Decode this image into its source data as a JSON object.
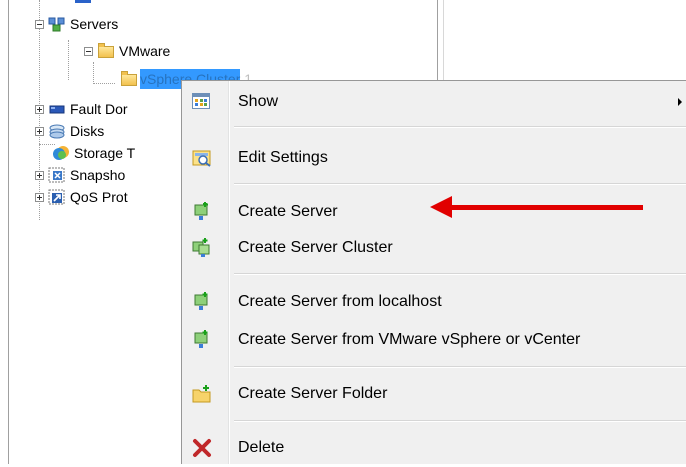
{
  "tree": {
    "items": [
      {
        "label": "Servers",
        "icon": "servers-icon"
      },
      {
        "label": "VMware",
        "icon": "folder-icon"
      },
      {
        "label": "vSphere Cluster 1",
        "icon": "folder-icon"
      },
      {
        "label": "Fault Dor",
        "icon": "fault-domain-icon"
      },
      {
        "label": "Disks",
        "icon": "disks-icon"
      },
      {
        "label": "Storage T",
        "icon": "storage-icon"
      },
      {
        "label": "Snapsho",
        "icon": "snapshot-icon"
      },
      {
        "label": "QoS Prot",
        "icon": "qos-icon"
      }
    ]
  },
  "context_menu": {
    "items": [
      {
        "label": "Show",
        "icon": "show-grid-icon",
        "has_submenu": true
      },
      {
        "label": "Edit Settings",
        "icon": "edit-settings-icon"
      },
      {
        "label": "Create Server",
        "icon": "create-server-icon"
      },
      {
        "label": "Create Server Cluster",
        "icon": "create-server-cluster-icon"
      },
      {
        "label": "Create Server from localhost",
        "icon": "create-server-localhost-icon"
      },
      {
        "label": "Create Server from VMware vSphere or vCenter",
        "icon": "create-server-vmware-icon"
      },
      {
        "label": "Create Server Folder",
        "icon": "create-folder-icon"
      },
      {
        "label": "Delete",
        "icon": "delete-icon"
      }
    ]
  },
  "colors": {
    "selection": "#3399ff",
    "annotation_arrow": "#e10000",
    "menu_bg": "#f0f0f0"
  }
}
